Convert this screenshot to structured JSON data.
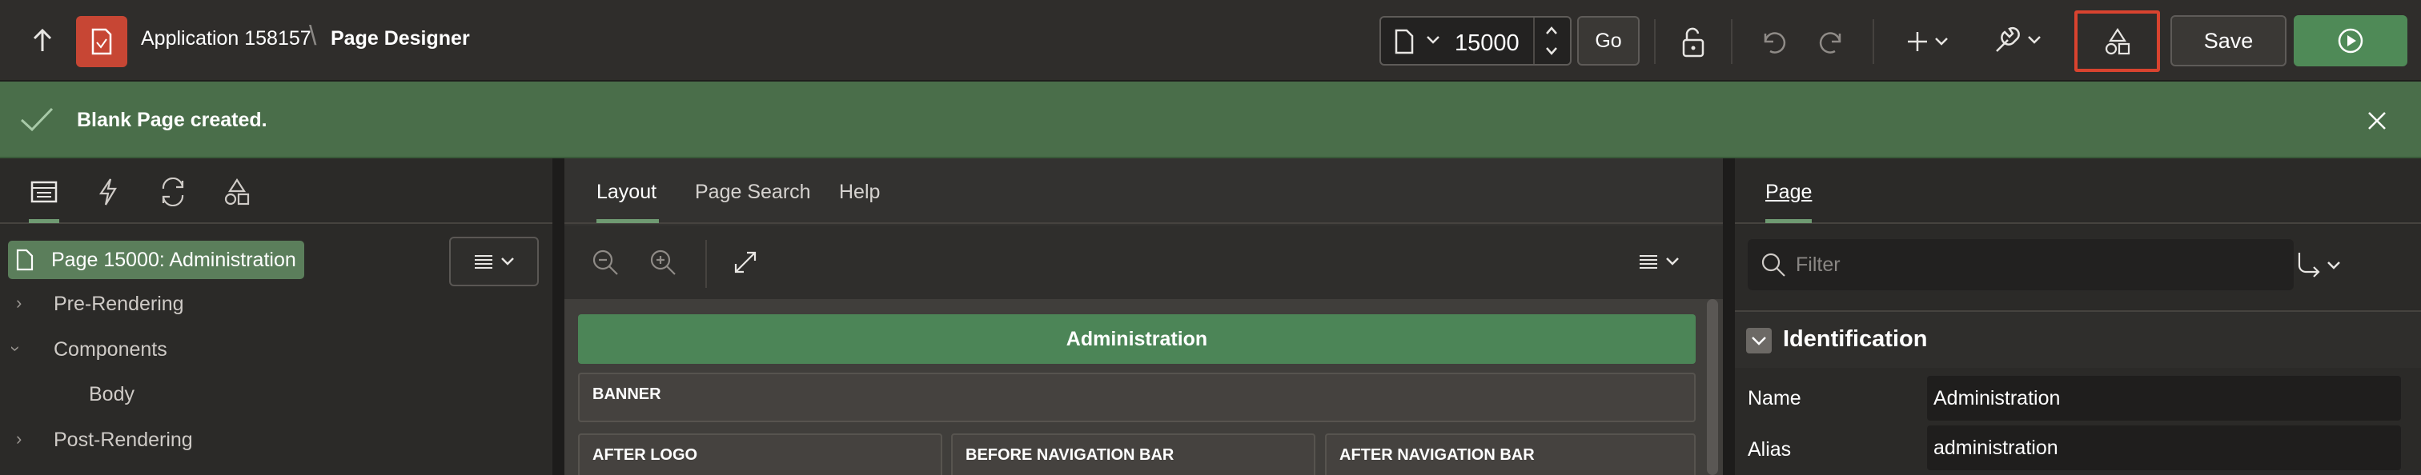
{
  "header": {
    "app_name": "Application 158157",
    "page_title": "Page Designer",
    "page_number": "15000",
    "go_label": "Go",
    "save_label": "Save"
  },
  "banner": {
    "message": "Blank Page created."
  },
  "left_pane": {
    "selected_page": "Page 15000: Administration",
    "tree": [
      {
        "label": "Pre-Rendering"
      },
      {
        "label": "Components"
      },
      {
        "label": "Body"
      },
      {
        "label": "Post-Rendering"
      }
    ]
  },
  "center_pane": {
    "tabs": [
      {
        "label": "Layout"
      },
      {
        "label": "Page Search"
      },
      {
        "label": "Help"
      }
    ],
    "region_title": "Administration",
    "slots": {
      "banner": "BANNER",
      "after_logo": "AFTER LOGO",
      "before_nav": "BEFORE NAVIGATION BAR",
      "after_nav": "AFTER NAVIGATION BAR"
    }
  },
  "right_pane": {
    "tab": "Page",
    "filter_placeholder": "Filter",
    "section": "Identification",
    "props": [
      {
        "label": "Name",
        "value": "Administration"
      },
      {
        "label": "Alias",
        "value": "administration"
      }
    ]
  },
  "colors": {
    "accent_green": "#4c8557",
    "banner_green": "#4a6e4a",
    "highlight_red": "#d9432f",
    "app_logo_red": "#c74634"
  }
}
